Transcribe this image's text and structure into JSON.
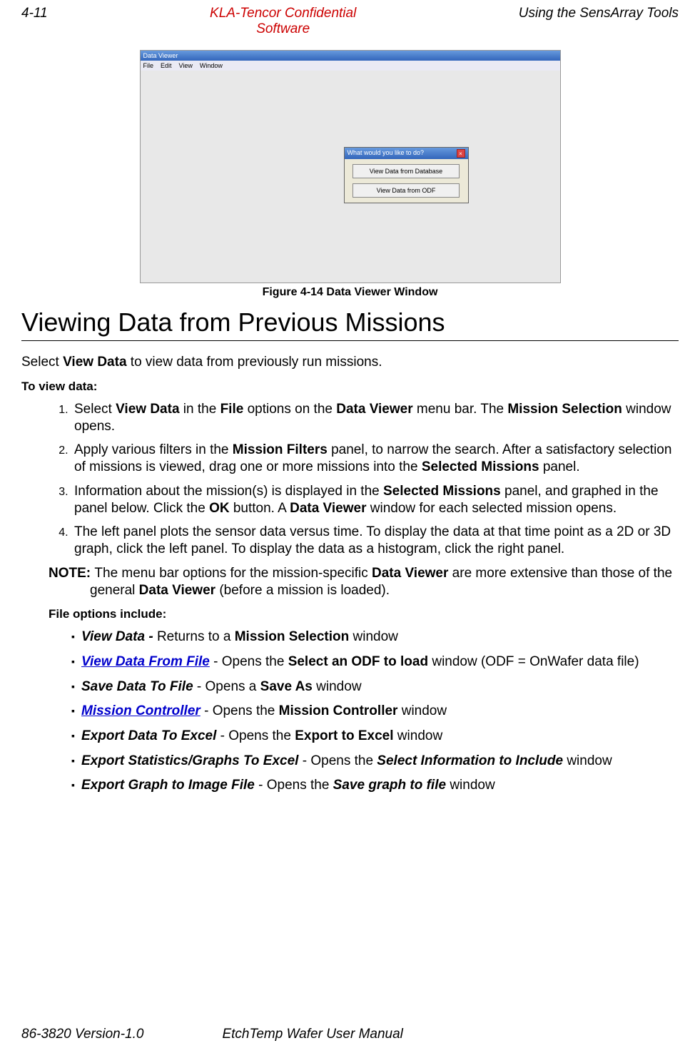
{
  "header": {
    "page_number": "4-11",
    "center_line1": "KLA-Tencor Confidential",
    "center_line2": "Software",
    "right": "Using the SensArray Tools"
  },
  "screenshot": {
    "window_title": "Data Viewer",
    "menus": [
      "File",
      "Edit",
      "View",
      "Window"
    ],
    "dialog_title": "What would you like to do?",
    "dialog_btn1": "View Data from Database",
    "dialog_btn2": "View Data from ODF"
  },
  "figure_caption": "Figure 4-14 Data Viewer Window",
  "section_heading": "Viewing Data from Previous Missions",
  "intro": {
    "pre": "Select ",
    "bold": "View Data",
    "post": " to view data from previously run missions."
  },
  "to_view": "To view data:",
  "steps": {
    "s1": {
      "a": "Select ",
      "b": "View Data",
      "c": " in the ",
      "d": "File",
      "e": " options on the ",
      "f": "Data Viewer",
      "g": " menu bar. The ",
      "h": "Mission Selection",
      "i": " window opens."
    },
    "s2": {
      "a": "Apply various filters in the ",
      "b": "Mission Filters",
      "c": " panel, to narrow the search. After a satisfactory selection of missions is viewed, drag one or more missions into the ",
      "d": "Selected Missions",
      "e": " panel."
    },
    "s3": {
      "a": "Information about the mission(s) is displayed in the ",
      "b": "Selected Missions",
      "c": " panel, and graphed in the panel below. Click the ",
      "d": "OK",
      "e": " button. A ",
      "f": "Data Viewer",
      "g": " window for each selected mission opens."
    },
    "s4": {
      "a": "The left panel plots the sensor data versus time. To display the data at that time point as a 2D or 3D graph, click the left panel. To display the data as a histogram, click the right panel."
    }
  },
  "note": {
    "label": "NOTE: ",
    "a": "The menu bar options for the mission-specific ",
    "b": "Data Viewer",
    "c": " are more extensive than those of the general ",
    "d": "Data Viewer",
    "e": " (before a mission is loaded)."
  },
  "file_options_label": "File options include:",
  "bullets": {
    "b1": {
      "name": "View Data - ",
      "a": "Returns to a ",
      "b": "Mission Selection",
      "c": " window"
    },
    "b2": {
      "name": "View Data From File",
      "sep": " - ",
      "a": "Opens the ",
      "b": "Select an ODF to load",
      "c": " window (ODF = OnWafer data file)"
    },
    "b3": {
      "name": "Save Data To File",
      "sep": " - ",
      "a": "Opens a ",
      "b": "Save As",
      "c": " window"
    },
    "b4": {
      "name": "Mission Controller",
      "sep": " - ",
      "a": "Opens the ",
      "b": "Mission Controller",
      "c": " window"
    },
    "b5": {
      "name": "Export Data To Excel",
      "sep": " - ",
      "a": "Opens the ",
      "b": "Export to Excel",
      "c": " window"
    },
    "b6": {
      "name": "Export Statistics/Graphs To Excel",
      "sep": " - ",
      "a": "Opens the ",
      "b": "Select Information to Include",
      "c": " window"
    },
    "b7": {
      "name": "Export Graph to Image File",
      "sep": " - ",
      "a": "Opens the ",
      "b": "Save graph to file",
      "c": " window"
    }
  },
  "footer": {
    "left": "86-3820 Version-1.0",
    "center": "EtchTemp Wafer User Manual"
  }
}
